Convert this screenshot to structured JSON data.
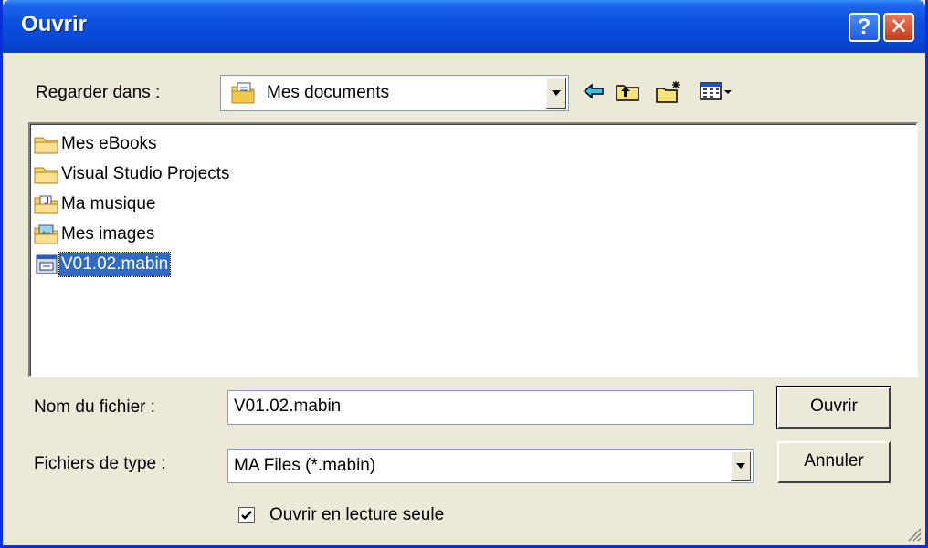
{
  "window": {
    "title": "Ouvrir",
    "help_label": "?",
    "close_label": "✕"
  },
  "lookin": {
    "label": "Regarder dans :",
    "value": "Mes documents"
  },
  "toolbar": {
    "icons": [
      "back-arrow-icon",
      "folder-up-icon",
      "new-folder-icon",
      "view-menu-icon"
    ]
  },
  "files": [
    {
      "name": "Mes eBooks",
      "icon": "folder-icon"
    },
    {
      "name": "Visual Studio Projects",
      "icon": "folder-icon"
    },
    {
      "name": "Ma musique",
      "icon": "music-folder-icon"
    },
    {
      "name": "Mes images",
      "icon": "pictures-folder-icon"
    },
    {
      "name": "V01.02.mabin",
      "icon": "file-icon",
      "selected": true
    }
  ],
  "filename": {
    "label": "Nom du fichier :",
    "value": "V01.02.mabin"
  },
  "filetype": {
    "label": "Fichiers de type :",
    "value": "MA Files (*.mabin)"
  },
  "buttons": {
    "open_label": "Ouvrir",
    "cancel_label": "Annuler"
  },
  "readonly": {
    "label": "Ouvrir en lecture seule",
    "checked": true
  },
  "colors": {
    "titlebar": "#0a4fe0",
    "selection": "#316ac5",
    "face": "#ece9d8"
  }
}
